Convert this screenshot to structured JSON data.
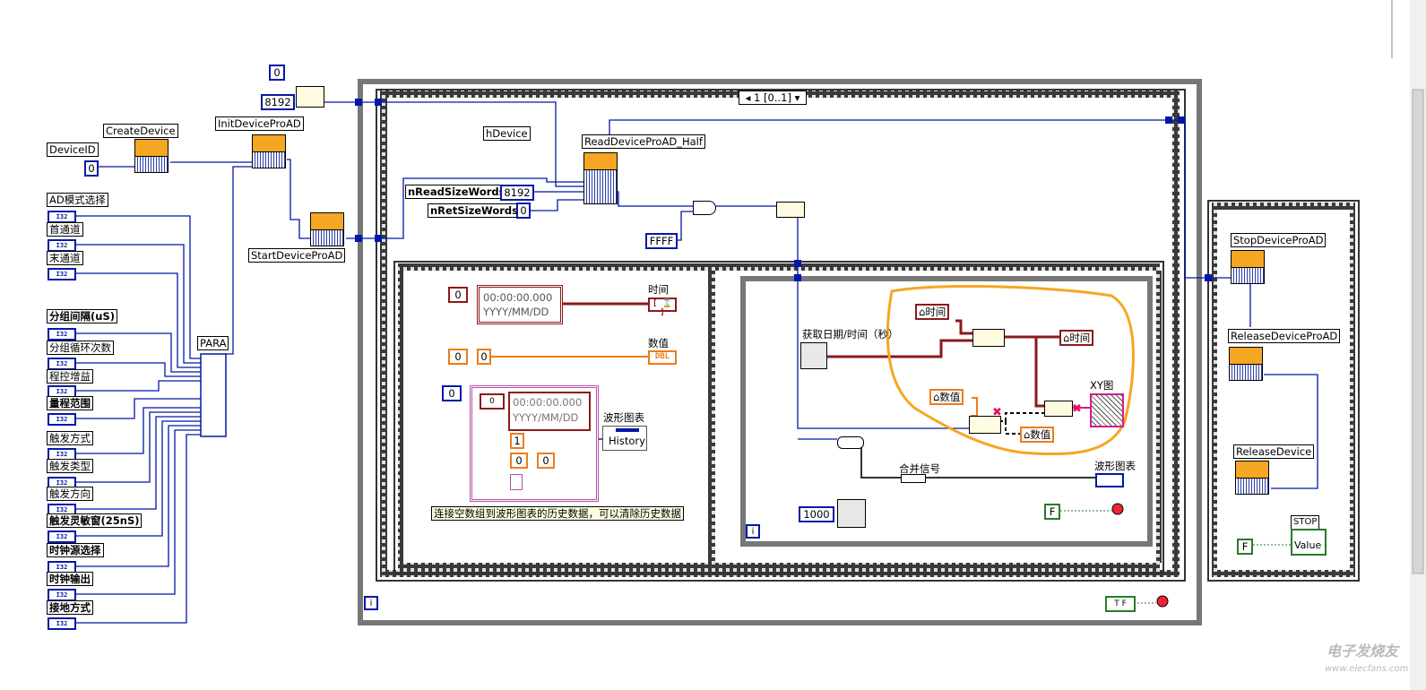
{
  "diagram": {
    "create_device": "CreateDevice",
    "device_id_label": "DeviceID",
    "device_id_value": "0",
    "init_device": "InitDeviceProAD",
    "init_const_0": "0",
    "init_const_8192": "8192",
    "start_device": "StartDeviceProAD",
    "hdevice": "hDevice",
    "read_device": "ReadDeviceProAD_Half",
    "nread_label": "nReadSizeWords",
    "nread_value": "8192",
    "nret_label": "nRetSizeWords",
    "nret_value": "0",
    "ffff": "FFFF",
    "case_selector": "1 [0..1]",
    "para_label": "PARA",
    "params": [
      "AD模式选择",
      "首通道",
      "末通道",
      "分组间隔(uS)",
      "分组循环次数",
      "程控增益",
      "量程范围",
      "触发方式",
      "触发类型",
      "触发方向",
      "触发灵敏窗(25nS)",
      "时钟源选择",
      "时钟输出",
      "接地方式"
    ],
    "i32_text": "I32",
    "left_panel": {
      "ts_const_index": "0",
      "ts_time": "00:00:00.000",
      "ts_date": "YYYY/MM/DD",
      "time_label": "时间",
      "num_index": "0",
      "num_value": "0",
      "num_label": "数值",
      "dbl": "DBL",
      "arr_index": "0",
      "arr_time": "00:00:00.000",
      "arr_date": "YYYY/MM/DD",
      "arr_one": "1",
      "arr_zero": "0",
      "arr_zero2": "0",
      "waveform_label": "波形图表",
      "history": "History",
      "note": "连接空数组到波形图表的历史数据，可以清除历史数据"
    },
    "right_panel": {
      "get_datetime": "获取日期/时间（秒）",
      "time_in": "时间",
      "time_out": "时间",
      "num_in": "数值",
      "num_out": "数值",
      "xy_label": "XY图",
      "merge_label": "合并信号",
      "waveform_label": "波形图表",
      "wait_ms": "1000",
      "bool_f": "F",
      "loop_i": "i"
    },
    "outer_loop_i": "i",
    "tf_const": "T F",
    "stop_device": "StopDeviceProAD",
    "release_proad": "ReleaseDeviceProAD",
    "release_device": "ReleaseDevice",
    "stop_label": "STOP",
    "stop_value": "Value",
    "stop_f": "F",
    "watermark": "电子发烧友",
    "watermark_url": "www.elecfans.com"
  },
  "colors": {
    "wire_blue": "#0018a8",
    "wire_orange": "#ee7c1a",
    "wire_brown": "#8b1a1a",
    "wire_green": "#2a7a2a",
    "annotation": "#f5a623"
  }
}
